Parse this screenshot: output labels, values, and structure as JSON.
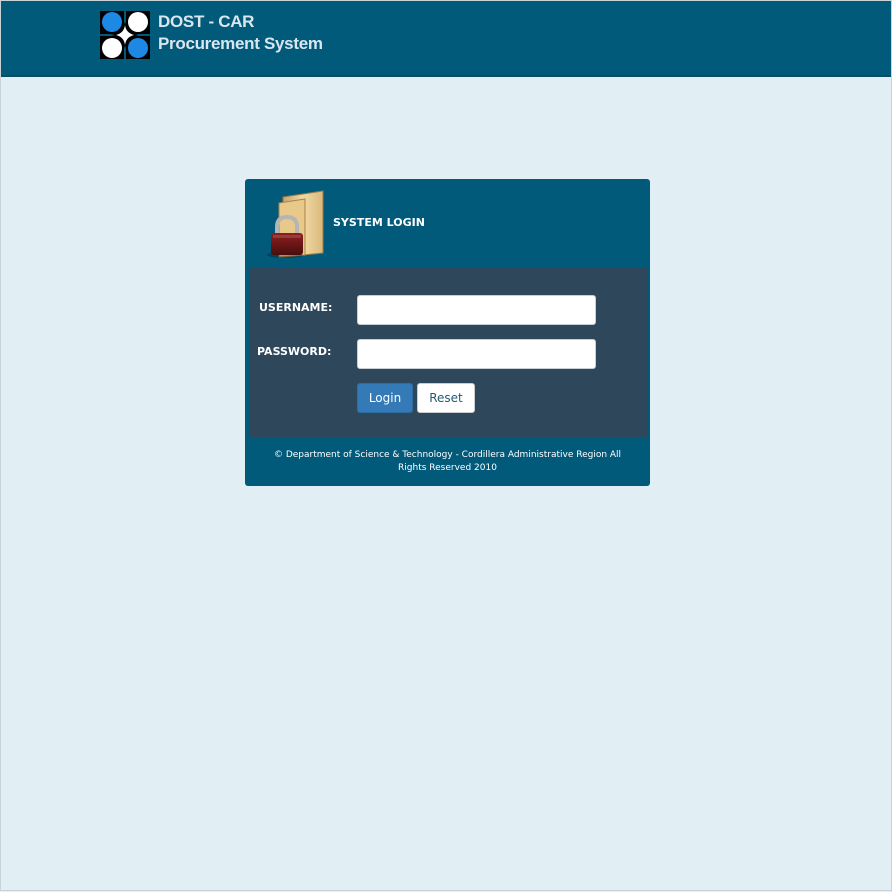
{
  "header": {
    "brand_line1": "DOST - CAR",
    "brand_line2": "Procurement System",
    "logo_icon": "dost-logo-icon"
  },
  "login": {
    "title": "SYSTEM LOGIN",
    "title_icon": "padlock-folder-icon",
    "username_label": "USERNAME:",
    "password_label": "PASSWORD:",
    "username_value": "",
    "password_value": "",
    "login_button": "Login",
    "reset_button": "Reset",
    "footer_text": "© Department of Science & Technology - Cordillera Administrative Region All Rights Reserved 2010"
  },
  "colors": {
    "header_bg": "#025a7b",
    "page_bg": "#e1eef4",
    "form_bg": "#2e475a",
    "primary_button": "#337ab7"
  }
}
